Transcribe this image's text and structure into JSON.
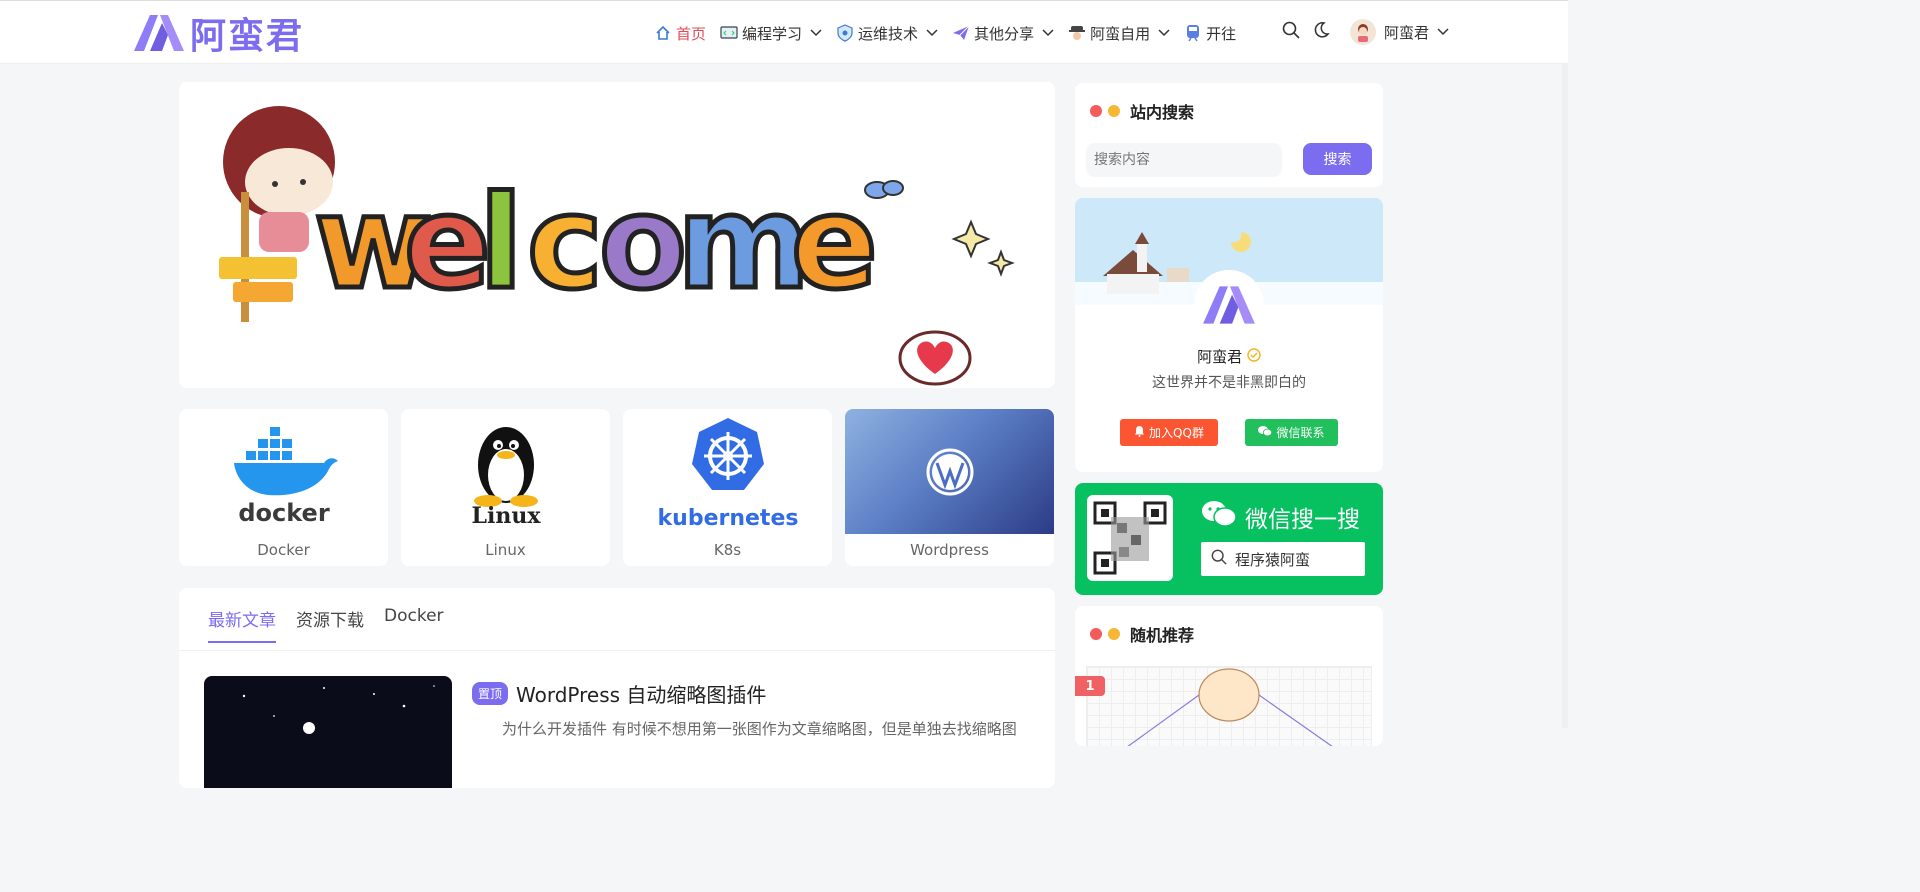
{
  "site": {
    "logo_text": "阿蛮君"
  },
  "nav": {
    "items": [
      {
        "label": "首页",
        "active": true
      },
      {
        "label": "编程学习",
        "dropdown": true
      },
      {
        "label": "运维技术",
        "dropdown": true
      },
      {
        "label": "其他分享",
        "dropdown": true
      },
      {
        "label": "阿蛮自用",
        "dropdown": true
      },
      {
        "label": "开往",
        "dropdown": false
      }
    ],
    "user_name": "阿蛮君"
  },
  "categories": [
    {
      "label": "Docker",
      "logo_text": "docker"
    },
    {
      "label": "Linux",
      "logo_text": "Linux"
    },
    {
      "label": "K8s",
      "logo_text": "kubernetes"
    },
    {
      "label": "Wordpress"
    }
  ],
  "posts": {
    "tabs": [
      "最新文章",
      "资源下载",
      "Docker"
    ],
    "items": [
      {
        "badge": "置顶",
        "title": "WordPress 自动缩略图插件",
        "excerpt": "为什么开发插件 有时候不想用第一张图作为文章缩略图，但是单独去找缩略图"
      }
    ]
  },
  "sidebar": {
    "search": {
      "title": "站内搜索",
      "placeholder": "搜索内容",
      "button": "搜索"
    },
    "profile": {
      "name": "阿蛮君",
      "bio": "这世界并不是非黑即白的",
      "qq_button": "加入QQ群",
      "wechat_button": "微信联系"
    },
    "wechat": {
      "title": "微信搜一搜",
      "search_text": "程序猿阿蛮"
    },
    "random": {
      "title": "随机推荐",
      "rank": "1"
    }
  },
  "colors": {
    "accent": "#7b6cf0",
    "active_nav": "#e04b59",
    "dot_red": "#f45b5b",
    "dot_yellow": "#f7b733",
    "wechat_green": "#07c160",
    "qq_orange": "#fc5531"
  }
}
